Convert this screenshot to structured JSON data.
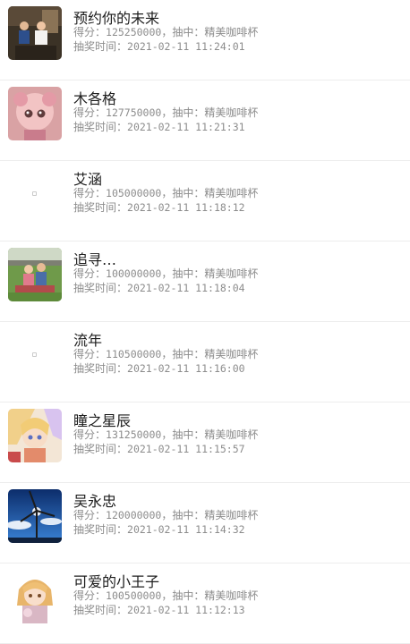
{
  "labels": {
    "score": "得分：",
    "prize_sep": "，抽中：",
    "time": "抽奖时间："
  },
  "records": [
    {
      "name": "预约你的未来",
      "score": "125250000",
      "prize": "精美咖啡杯",
      "time": "2021-02-11 11:24:01",
      "avatar_icon": "photo-family-avatar"
    },
    {
      "name": "木各格",
      "score": "127750000",
      "prize": "精美咖啡杯",
      "time": "2021-02-11 11:21:31",
      "avatar_icon": "doll-avatar"
    },
    {
      "name": "艾涵",
      "score": "105000000",
      "prize": "精美咖啡杯",
      "time": "2021-02-11 11:18:12",
      "avatar_icon": "blank-avatar"
    },
    {
      "name": "追寻…",
      "score": "100000000",
      "prize": "精美咖啡杯",
      "time": "2021-02-11 11:18:04",
      "avatar_icon": "kids-on-grass-avatar"
    },
    {
      "name": "流年",
      "score": "110500000",
      "prize": "精美咖啡杯",
      "time": "2021-02-11 11:16:00",
      "avatar_icon": "blank-avatar"
    },
    {
      "name": "瞳之星辰",
      "score": "131250000",
      "prize": "精美咖啡杯",
      "time": "2021-02-11 11:15:57",
      "avatar_icon": "anime-girl-avatar"
    },
    {
      "name": "吴永忠",
      "score": "120000000",
      "prize": "精美咖啡杯",
      "time": "2021-02-11 11:14:32",
      "avatar_icon": "wind-turbine-avatar"
    },
    {
      "name": "可爱的小王子",
      "score": "100500000",
      "prize": "精美咖啡杯",
      "time": "2021-02-11 11:12:13",
      "avatar_icon": "anime-prince-avatar"
    }
  ]
}
